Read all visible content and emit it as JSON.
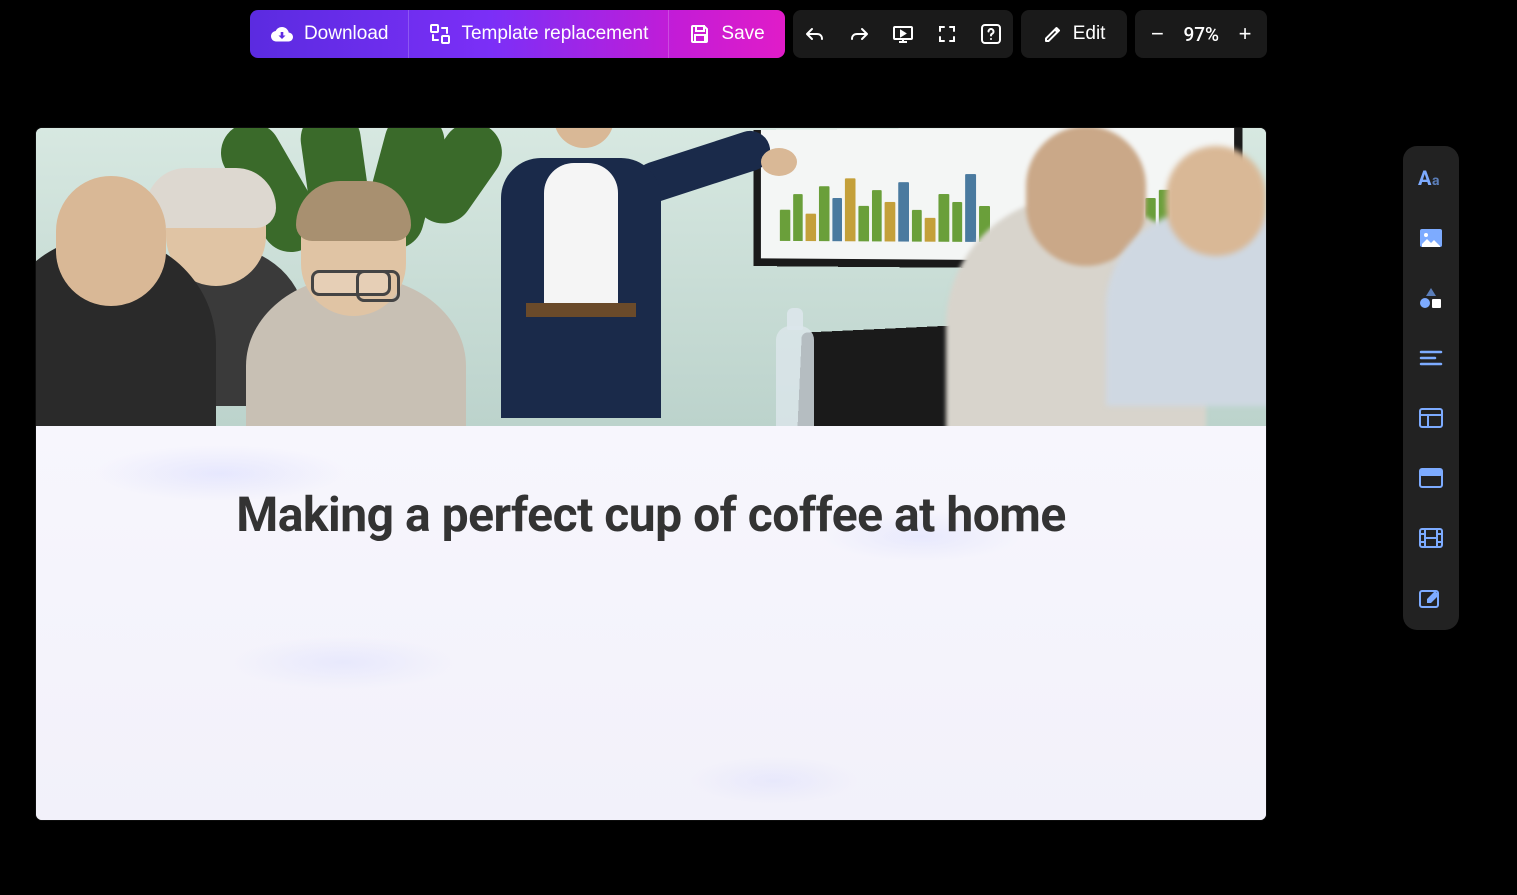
{
  "toolbar": {
    "download_label": "Download",
    "template_label": "Template replacement",
    "save_label": "Save",
    "edit_label": "Edit",
    "zoom_value": "97%"
  },
  "slide": {
    "title": "Making a perfect cup of coffee at home"
  },
  "side_tools": [
    "text-tool",
    "image-tool",
    "shapes-tool",
    "align-tool",
    "layout-tool",
    "header-tool",
    "film-tool",
    "draw-tool"
  ]
}
